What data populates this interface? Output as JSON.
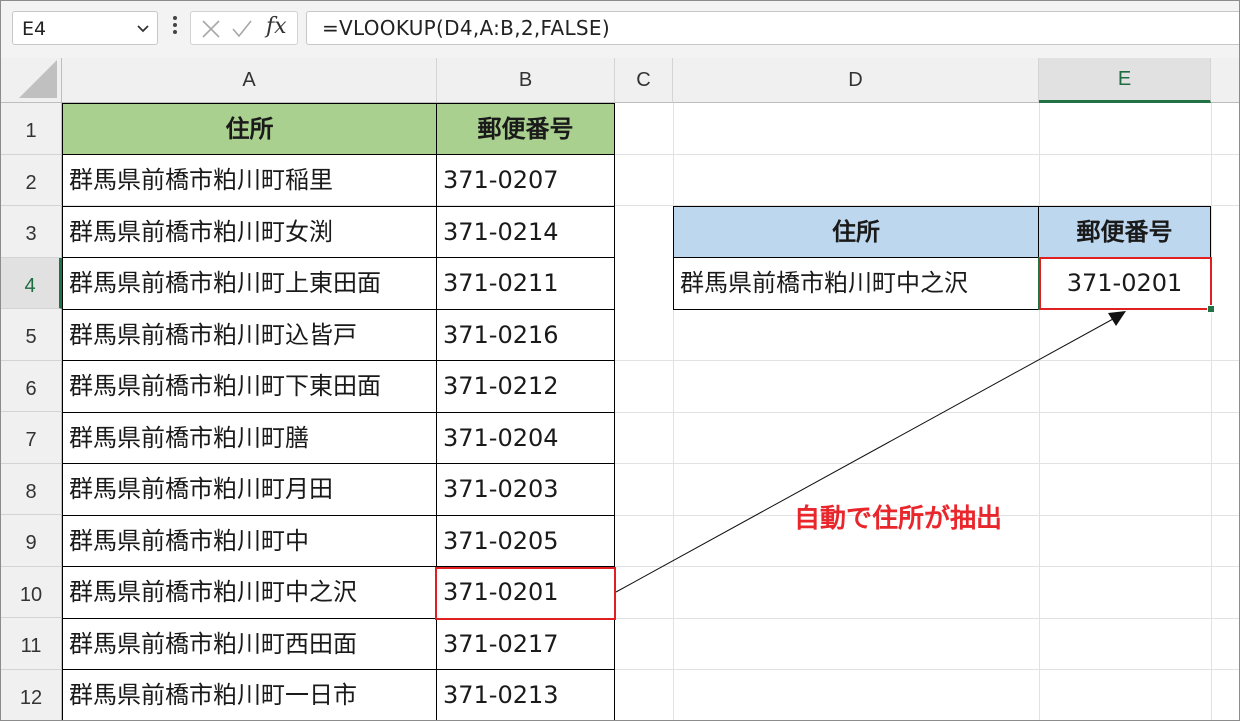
{
  "formula_bar": {
    "name_box": "E4",
    "fx_label": "fx",
    "formula": "=VLOOKUP(D4,A:B,2,FALSE)"
  },
  "columns": [
    "A",
    "B",
    "C",
    "D",
    "E"
  ],
  "rows": [
    "1",
    "2",
    "3",
    "4",
    "5",
    "6",
    "7",
    "8",
    "9",
    "10",
    "11",
    "12"
  ],
  "table": {
    "headers": [
      "住所",
      "郵便番号"
    ],
    "records": [
      [
        "群馬県前橋市粕川町稲里",
        "371-0207"
      ],
      [
        "群馬県前橋市粕川町女渕",
        "371-0214"
      ],
      [
        "群馬県前橋市粕川町上東田面",
        "371-0211"
      ],
      [
        "群馬県前橋市粕川町込皆戸",
        "371-0216"
      ],
      [
        "群馬県前橋市粕川町下東田面",
        "371-0212"
      ],
      [
        "群馬県前橋市粕川町膳",
        "371-0204"
      ],
      [
        "群馬県前橋市粕川町月田",
        "371-0203"
      ],
      [
        "群馬県前橋市粕川町中",
        "371-0205"
      ],
      [
        "群馬県前橋市粕川町中之沢",
        "371-0201"
      ],
      [
        "群馬県前橋市粕川町西田面",
        "371-0217"
      ],
      [
        "群馬県前橋市粕川町一日市",
        "371-0213"
      ]
    ]
  },
  "lookup": {
    "headers": [
      "住所",
      "郵便番号"
    ],
    "address": "群馬県前橋市粕川町中之沢",
    "result": "371-0201"
  },
  "annotation": "自動で住所が抽出",
  "colors": {
    "header_green": "#a9d08e",
    "header_blue": "#bdd7ee",
    "highlight_red": "#e02020",
    "annotation_red": "#e8262b",
    "excel_green": "#217346"
  }
}
